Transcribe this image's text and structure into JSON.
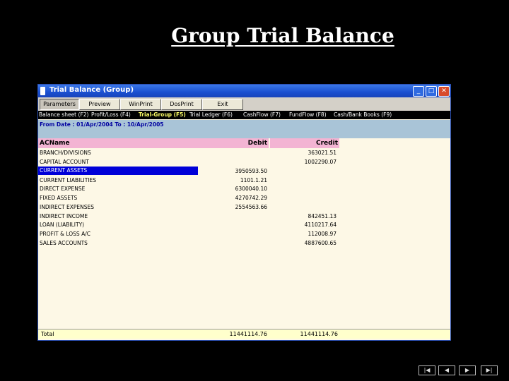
{
  "slide_title": "Group Trial Balance",
  "window": {
    "title": "Trial Balance (Group)",
    "controls": {
      "minimize": "_",
      "maximize": "□",
      "close": "✕"
    }
  },
  "toolbar": {
    "buttons": [
      "Parameters",
      "Preview",
      "WinPrint",
      "DosPrint",
      "Exit"
    ]
  },
  "menu": {
    "items": [
      "Balance sheet (F2)",
      "Profit/Loss (F4)",
      "Trial-Group (F5)",
      "Trial Ledger (F6)",
      "CashFlow (F7)",
      "FundFlow (F8)",
      "Cash/Bank Books (F9)"
    ]
  },
  "date_range": "From Date : 01/Apr/2004 To : 10/Apr/2005",
  "table": {
    "headers": {
      "name": "ACName",
      "debit": "Debit",
      "credit": "Credit"
    },
    "rows": [
      {
        "name": "BRANCH/DIVISIONS",
        "debit": "",
        "credit": "363021.51"
      },
      {
        "name": "CAPITAL ACCOUNT",
        "debit": "",
        "credit": "1002290.07"
      },
      {
        "name": "CURRENT ASSETS",
        "debit": "3950593.50",
        "credit": ""
      },
      {
        "name": "CURRENT LIABILITIES",
        "debit": "1101.1.21",
        "credit": ""
      },
      {
        "name": "DIRECT EXPENSE",
        "debit": "6300040.10",
        "credit": ""
      },
      {
        "name": "FIXED ASSETS",
        "debit": "4270742.29",
        "credit": ""
      },
      {
        "name": "INDIRECT EXPENSES",
        "debit": "2554563.66",
        "credit": ""
      },
      {
        "name": "INDIRECT INCOME",
        "debit": "",
        "credit": "842451.13"
      },
      {
        "name": "LOAN (LIABILITY)",
        "debit": "",
        "credit": "4110217.64"
      },
      {
        "name": "PROFIT & LOSS A/C",
        "debit": "",
        "credit": "112008.97"
      },
      {
        "name": "SALES ACCOUNTS",
        "debit": "",
        "credit": "4887600.65"
      }
    ],
    "selected_row": "CURRENT ASSETS",
    "total": {
      "label": "Total",
      "debit": "11441114.76",
      "credit": "11441114.76"
    }
  },
  "nav_buttons": [
    "|◀",
    "◀",
    "▶",
    "▶|"
  ],
  "colors": {
    "titlebar": "#1a4fd0",
    "header": "#f3b4d3",
    "date_bar": "#a9c4d7",
    "selection": "#0000d8",
    "body": "#fdf8e6"
  }
}
